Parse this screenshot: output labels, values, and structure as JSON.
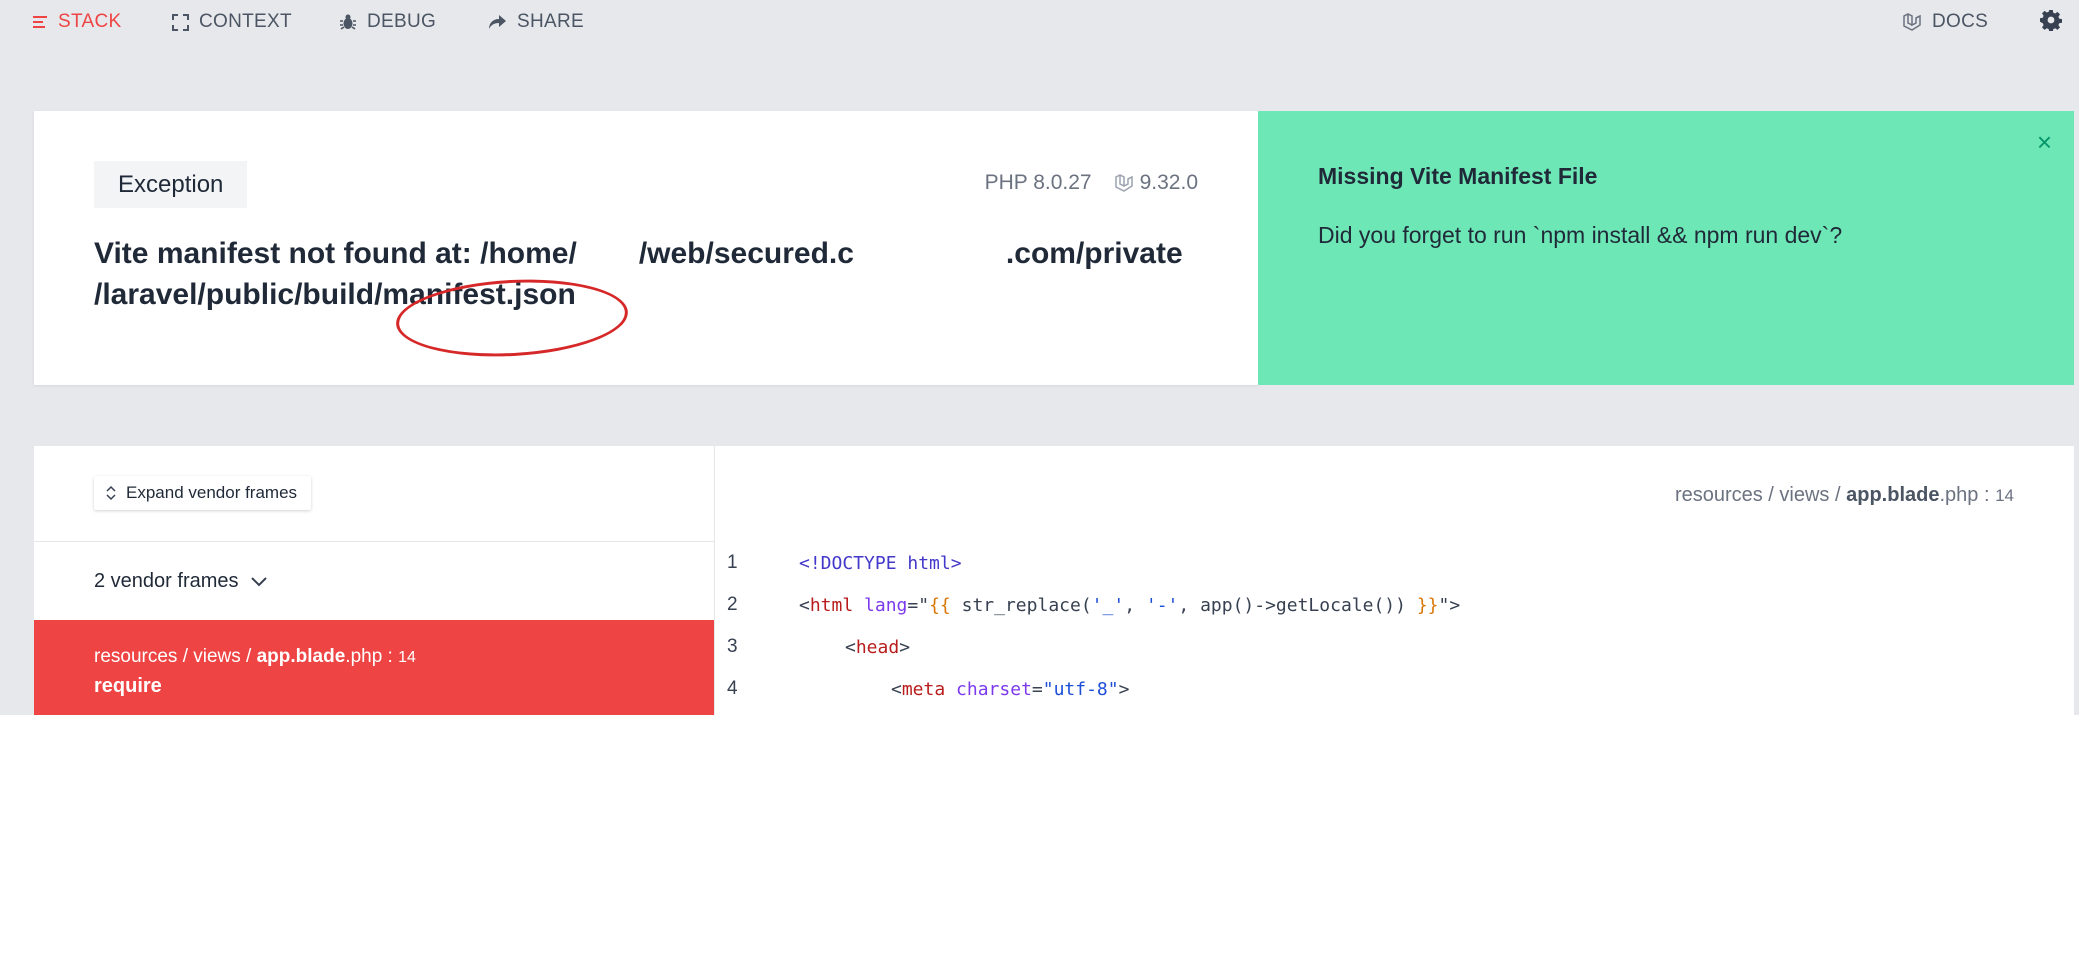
{
  "nav": {
    "stack": "STACK",
    "context": "CONTEXT",
    "debug": "DEBUG",
    "share": "SHARE",
    "docs": "DOCS"
  },
  "exception": {
    "badge": "Exception",
    "php_version": "PHP 8.0.27",
    "laravel_version": "9.32.0",
    "message_line1_a": "Vite manifest not found at: /home/",
    "message_line1_b": "/web/secured.c",
    "message_line1_c": ".com/private",
    "message_line2": "/laravel/public/build/manifest.json"
  },
  "solution": {
    "title": "Missing Vite Manifest File",
    "text": "Did you forget to run `npm install && npm run dev`?",
    "close": "×"
  },
  "stack": {
    "expand_label": "Expand vendor frames",
    "vendor_frames_label": "2 vendor frames",
    "active_frame": {
      "path_prefix": "resources / views / ",
      "file_bold": "app.blade",
      "file_ext": ".php",
      "line_sep": " : ",
      "line": "14",
      "function": "require"
    }
  },
  "code": {
    "path_prefix": "resources / views / ",
    "file_bold": "app.blade",
    "file_ext": ".php",
    "line_sep": " : ",
    "line": "14",
    "lines": [
      {
        "num": "1"
      },
      {
        "num": "2"
      },
      {
        "num": "3"
      },
      {
        "num": "4"
      }
    ],
    "tokens": {
      "l1_doctype": "<!DOCTYPE html>",
      "l2_open": "<",
      "l2_tag": "html",
      "l2_attr": "lang",
      "l2_eq": "=\"",
      "l2_bl_open": "{{",
      "l2_expr": " str_replace(",
      "l2_s1": "'_'",
      "l2_comma": ", ",
      "l2_s2": "'-'",
      "l2_expr2": ", app()->getLocale()) ",
      "l2_bl_close": "}}",
      "l2_close": "\">",
      "l3_open": "<",
      "l3_tag": "head",
      "l3_close": ">",
      "l4_open": "<",
      "l4_tag": "meta",
      "l4_attr": "charset",
      "l4_eq": "=",
      "l4_val": "\"utf-8\"",
      "l4_close": ">"
    }
  }
}
